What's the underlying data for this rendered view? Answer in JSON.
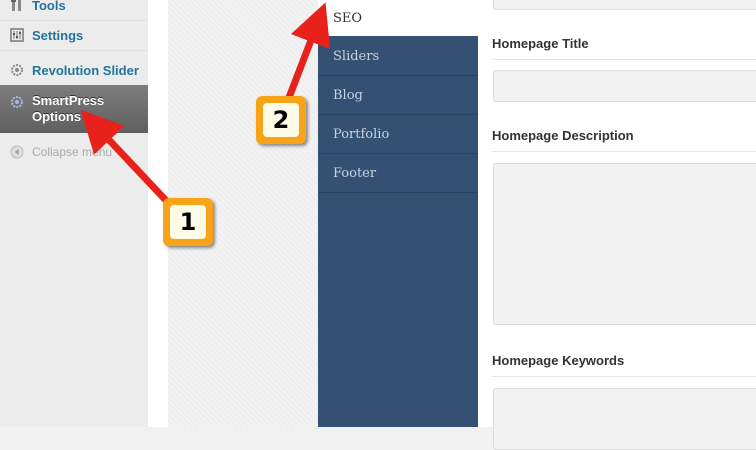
{
  "admin_menu": {
    "items": [
      {
        "label": "Tools",
        "icon": "tools-icon"
      },
      {
        "label": "Settings",
        "icon": "settings-icon"
      },
      {
        "label": "Revolution Slider",
        "icon": "gear-icon"
      },
      {
        "label": "SmartPress Options",
        "icon": "gear-icon",
        "active": true
      },
      {
        "label": "Collapse menu",
        "icon": "collapse-arrow-icon"
      }
    ]
  },
  "options_tabs": [
    {
      "label": "SEO",
      "active": true
    },
    {
      "label": "Sliders"
    },
    {
      "label": "Blog"
    },
    {
      "label": "Portfolio"
    },
    {
      "label": "Footer"
    }
  ],
  "seo_form": {
    "homepage_title_label": "Homepage Title",
    "homepage_title_value": "",
    "homepage_description_label": "Homepage Description",
    "homepage_description_value": "",
    "homepage_keywords_label": "Homepage Keywords",
    "homepage_keywords_value": ""
  },
  "annotations": {
    "step_1": "1",
    "step_2": "2"
  },
  "colors": {
    "tab_background": "#345073",
    "annotation_arrow": "#e8221b",
    "badge_fill": "#f7a419",
    "menu_link": "#21759b"
  }
}
